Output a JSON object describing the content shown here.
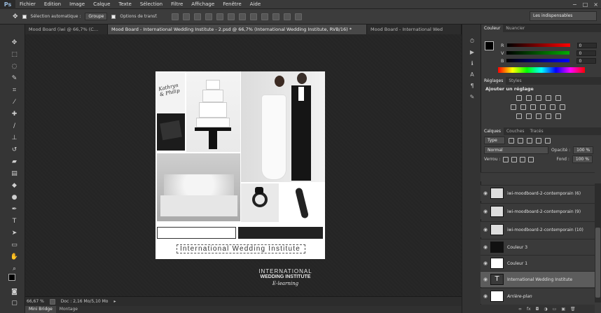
{
  "app": {
    "logo": "Ps"
  },
  "menu": [
    "Fichier",
    "Edition",
    "Image",
    "Calque",
    "Texte",
    "Sélection",
    "Filtre",
    "Affichage",
    "Fenêtre",
    "Aide"
  ],
  "window_controls": [
    "−",
    "□",
    "×"
  ],
  "options": {
    "auto_select": "Sélection automatique :",
    "group_value": "Groupe",
    "transform": "Options de transf.",
    "workspace": "Les indispensables"
  },
  "tabs": [
    {
      "label": "Mood Board (iwi @ 66,7% (C…",
      "active": false
    },
    {
      "label": "Mood Board - International Wedding Institute - 2.psd @ 66,7% (International Wedding Institute, RVB/16) *",
      "active": true
    },
    {
      "label": "Mood Board - International Wed",
      "active": false
    }
  ],
  "document": {
    "title_text": "International Wedding Institute",
    "invitation_text": "Kathryn & Philip"
  },
  "brand": {
    "line1": "INTERNATIONAL",
    "line2": "WEDDING INSTITUTE",
    "line3": "E-learning"
  },
  "status": {
    "zoom": "66,67 %",
    "doc": "Doc : 2,16 Mo/5,10 Mo"
  },
  "bottom_tabs": [
    {
      "label": "Mini Bridge",
      "active": true
    },
    {
      "label": "Montage",
      "active": false
    }
  ],
  "color_panel": {
    "tabs": [
      "Couleur",
      "Nuancier"
    ],
    "channels": [
      {
        "name": "R",
        "value": "0"
      },
      {
        "name": "V",
        "value": "0"
      },
      {
        "name": "B",
        "value": "0"
      }
    ]
  },
  "adjust_panel": {
    "tabs": [
      "Réglages",
      "Styles"
    ],
    "title": "Ajouter un réglage"
  },
  "layers_panel": {
    "tabs": [
      "Calques",
      "Couches",
      "Tracés"
    ],
    "filter": "Type",
    "blend": "Normal",
    "opacity_label": "Opacité :",
    "opacity": "100 %",
    "lock_label": "Verrou :",
    "fill_label": "Fond :",
    "fill": "100 %",
    "layers": [
      {
        "name": "iwi-moodboard-2-contemporain (6)",
        "selected": false
      },
      {
        "name": "iwi-moodboard-2-contemporain (9)",
        "selected": false
      },
      {
        "name": "iwi-moodboard-2-contemporain (10)",
        "selected": false
      },
      {
        "name": "Couleur 3",
        "selected": false
      },
      {
        "name": "Couleur 1",
        "selected": false
      },
      {
        "name": "International Wedding Institute",
        "selected": true
      },
      {
        "name": "Arrière-plan",
        "selected": false
      }
    ]
  },
  "colors": {
    "accent_selected": "#5c5c5c",
    "background": "#282828"
  }
}
